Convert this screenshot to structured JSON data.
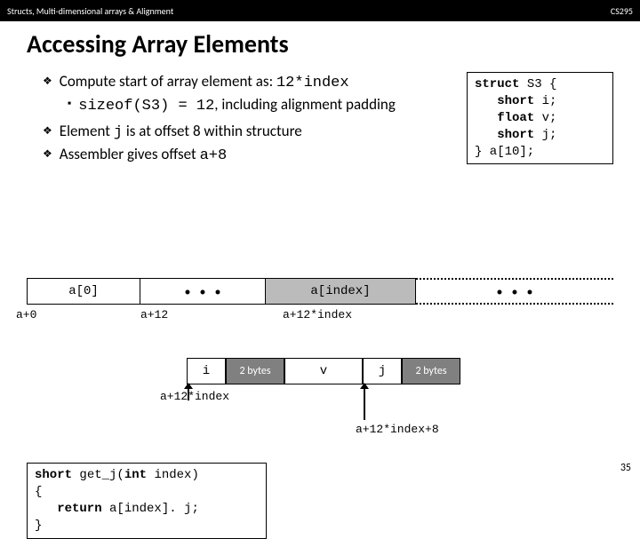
{
  "hdr": {
    "left": "Structs, Multi-dimensional arrays & Alignment",
    "right": "CS295"
  },
  "title": "Accessing Array Elements",
  "bullet1_a": "Compute start of array element as: ",
  "bullet1_b": "12*index",
  "bullet1s_a": "sizeof(S3) = 12",
  "bullet1s_b": ", including alignment padding",
  "bullet2_a": "Element ",
  "bullet2_b": "j",
  "bullet2_c": " is at offset 8 within structure",
  "bullet3_a": "Assembler gives offset ",
  "bullet3_b": "a+8",
  "struct": {
    "l1a": "struct",
    "l1b": " S3 {",
    "l2a": "   short",
    "l2b": " i;",
    "l3a": "   float",
    "l3b": " v;",
    "l4a": "   short",
    "l4b": " j;",
    "l5": "} a[10];"
  },
  "arr": {
    "c0": "a[0]",
    "ci": "a[index]",
    "lab0": "a+0",
    "lab12": "a+12",
    "labidx": "a+12*index"
  },
  "srow": {
    "i": "i",
    "p": "2 bytes",
    "v": "v",
    "j": "j",
    "p2": "2 bytes",
    "below": "a+12*index",
    "right": "a+12*index+8"
  },
  "code": {
    "l1a": "short",
    "l1b": " get_j(",
    "l1c": "int",
    "l1d": " index)",
    "l2": "{",
    "l3a": "   return",
    "l3b": " a[index]. j;",
    "l4": "}"
  },
  "pageno": "35"
}
